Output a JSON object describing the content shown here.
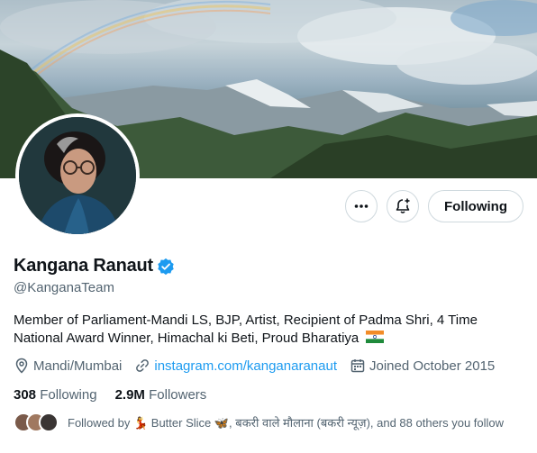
{
  "profile": {
    "display_name": "Kangana Ranaut",
    "handle": "@KanganaTeam",
    "bio": "Member of Parliament-Mandi LS, BJP, Artist, Recipient of Padma Shri, 4 Time National Award Winner, Himachal ki Beti, Proud Bharatiya",
    "flag_icon": "india-flag",
    "location": "Mandi/Mumbai",
    "website": "instagram.com/kanganaranaut",
    "joined": "Joined October 2015"
  },
  "actions": {
    "more_icon": "more-icon",
    "notify_icon": "bell-plus-icon",
    "follow_label": "Following"
  },
  "stats": {
    "following_count": "308",
    "following_label": "Following",
    "followers_count": "2.9M",
    "followers_label": "Followers"
  },
  "followed_by": {
    "text": "Followed by 💃 Butter Slice 🦋, बकरी वाले मौलाना (बकरी न्यूज़), and 88 others you follow"
  },
  "colors": {
    "link": "#1d9bf0",
    "verified": "#1d9bf0",
    "secondary_text": "#536471",
    "primary_text": "#0f1419"
  }
}
